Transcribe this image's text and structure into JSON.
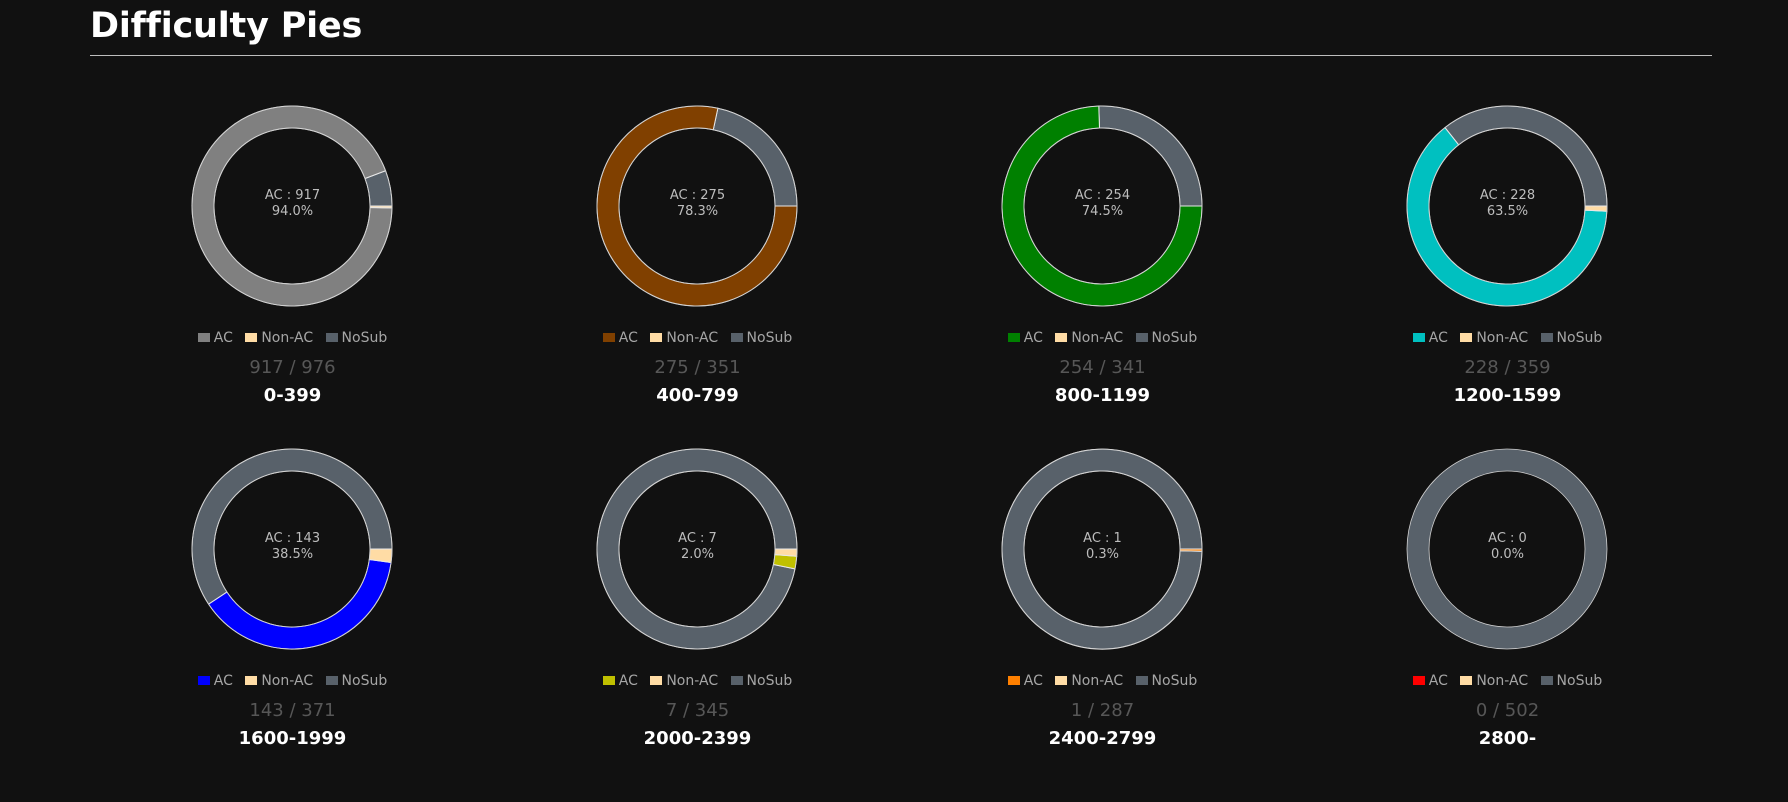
{
  "page": {
    "title": "Difficulty Pies"
  },
  "colors": {
    "background": "#111111",
    "non_ac": "#ffdca5",
    "nosub": "#58616a",
    "segment_border": "#e8e8e8"
  },
  "chart_data": [
    {
      "type": "pie",
      "title": "0-399",
      "ac": 917,
      "non_ac": 3,
      "nosub": 56,
      "total": 976,
      "ac_label": "AC : 917",
      "pct_label": "94.0%",
      "fraction_label": "917 / 976",
      "ac_color": "#808080",
      "legend": [
        "AC",
        "Non-AC",
        "NoSub"
      ]
    },
    {
      "type": "pie",
      "title": "400-799",
      "ac": 275,
      "non_ac": 0,
      "nosub": 76,
      "total": 351,
      "ac_label": "AC : 275",
      "pct_label": "78.3%",
      "fraction_label": "275 / 351",
      "ac_color": "#804000",
      "legend": [
        "AC",
        "Non-AC",
        "NoSub"
      ]
    },
    {
      "type": "pie",
      "title": "800-1199",
      "ac": 254,
      "non_ac": 0,
      "nosub": 87,
      "total": 341,
      "ac_label": "AC : 254",
      "pct_label": "74.5%",
      "fraction_label": "254 / 341",
      "ac_color": "#008000",
      "legend": [
        "AC",
        "Non-AC",
        "NoSub"
      ]
    },
    {
      "type": "pie",
      "title": "1200-1599",
      "ac": 228,
      "non_ac": 3,
      "nosub": 128,
      "total": 359,
      "ac_label": "AC : 228",
      "pct_label": "63.5%",
      "fraction_label": "228 / 359",
      "ac_color": "#00c0c0",
      "legend": [
        "AC",
        "Non-AC",
        "NoSub"
      ]
    },
    {
      "type": "pie",
      "title": "1600-1999",
      "ac": 143,
      "non_ac": 8,
      "nosub": 220,
      "total": 371,
      "ac_label": "AC : 143",
      "pct_label": "38.5%",
      "fraction_label": "143 / 371",
      "ac_color": "#0000ff",
      "legend": [
        "AC",
        "Non-AC",
        "NoSub"
      ]
    },
    {
      "type": "pie",
      "title": "2000-2399",
      "ac": 7,
      "non_ac": 4,
      "nosub": 334,
      "total": 345,
      "ac_label": "AC : 7",
      "pct_label": "2.0%",
      "fraction_label": "7 / 345",
      "ac_color": "#c0c000",
      "legend": [
        "AC",
        "Non-AC",
        "NoSub"
      ]
    },
    {
      "type": "pie",
      "title": "2400-2799",
      "ac": 1,
      "non_ac": 0,
      "nosub": 286,
      "total": 287,
      "ac_label": "AC : 1",
      "pct_label": "0.3%",
      "fraction_label": "1 / 287",
      "ac_color": "#ff8000",
      "legend": [
        "AC",
        "Non-AC",
        "NoSub"
      ]
    },
    {
      "type": "pie",
      "title": "2800-",
      "ac": 0,
      "non_ac": 0,
      "nosub": 502,
      "total": 502,
      "ac_label": "AC : 0",
      "pct_label": "0.0%",
      "fraction_label": "0 / 502",
      "ac_color": "#ff0000",
      "legend": [
        "AC",
        "Non-AC",
        "NoSub"
      ]
    }
  ]
}
